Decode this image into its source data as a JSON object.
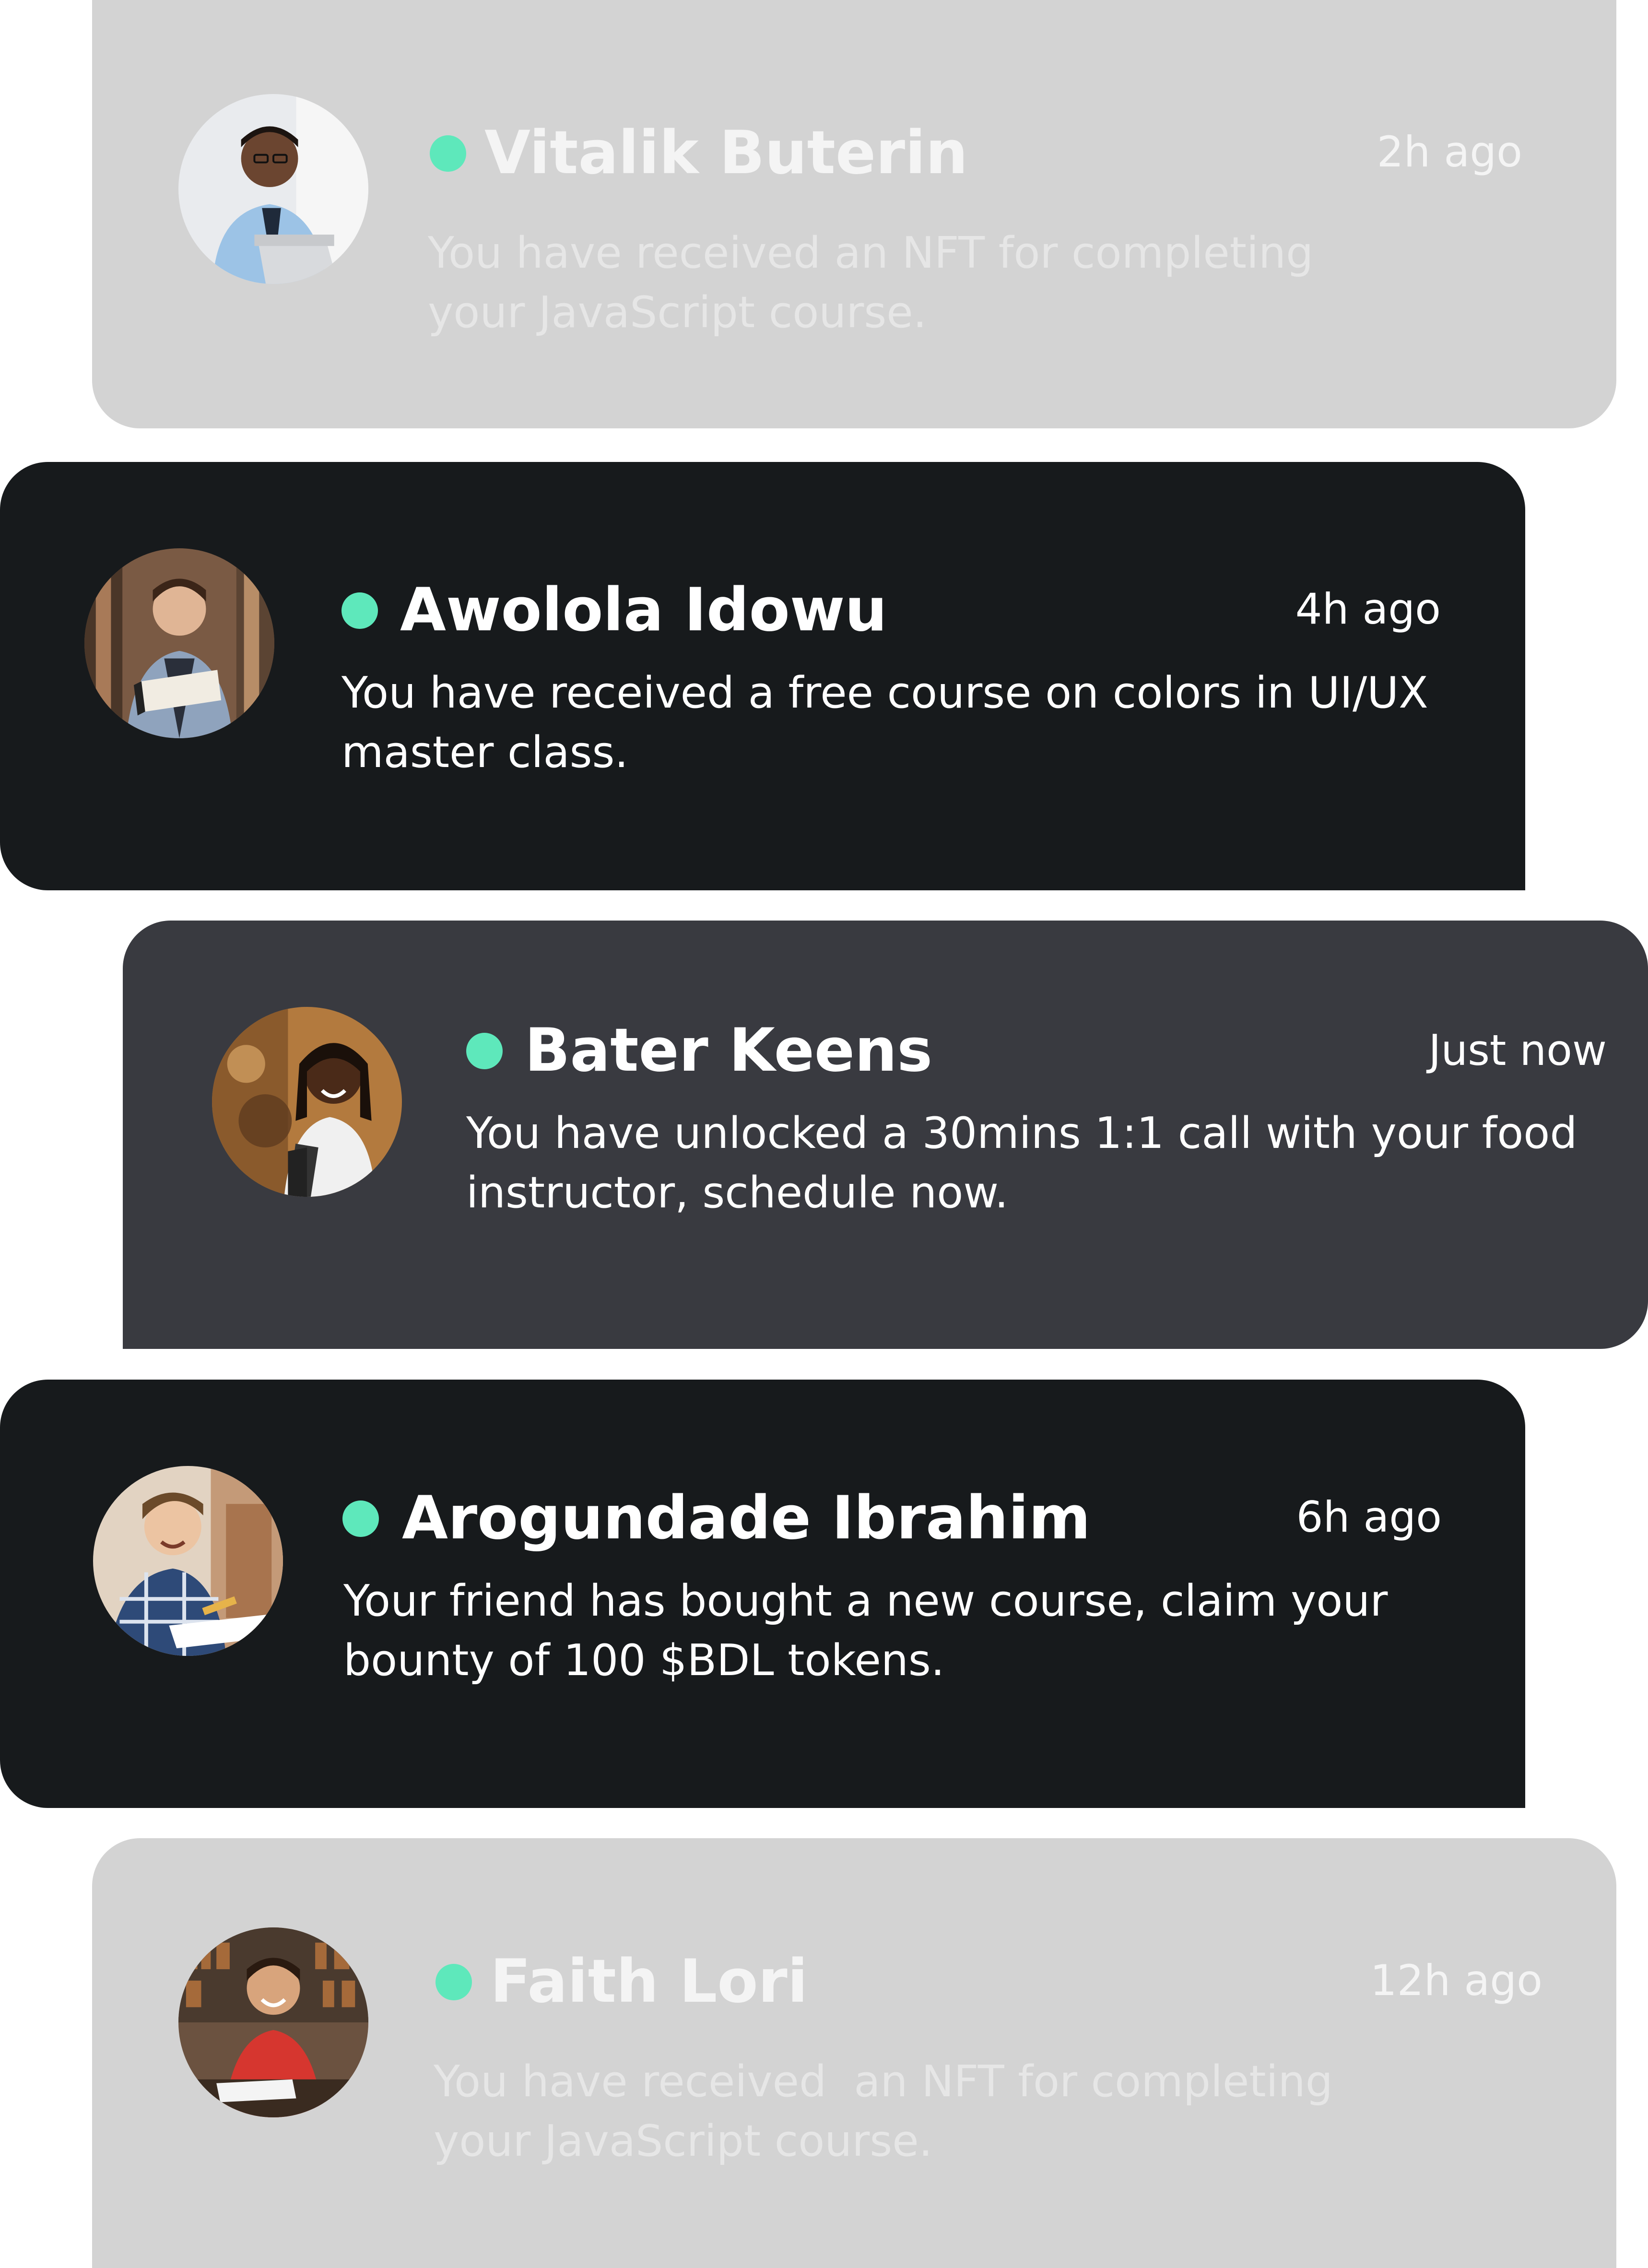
{
  "accent_color": "#5ee8bb",
  "notifications": [
    {
      "name": "Vitalik Buterin",
      "time": "2h ago",
      "message_line1": "You have received an NFT for completing",
      "message_line2": "your JavaScript course.",
      "theme": "light",
      "status": "online",
      "avatar": "man-with-laptop-photo"
    },
    {
      "name": "Awolola Idowu",
      "time": "4h ago",
      "message_line1": "You have received a free course on colors in UI/UX",
      "message_line2": "master class.",
      "theme": "dark",
      "status": "online",
      "avatar": "man-reading-book-photo"
    },
    {
      "name": "Bater Keens",
      "time": "Just now",
      "message_line1": "You have unlocked a 30mins 1:1 call with your food",
      "message_line2": "instructor, schedule now.",
      "theme": "mid",
      "status": "online",
      "avatar": "smiling-woman-backpack-photo"
    },
    {
      "name": "Arogundade Ibrahim",
      "time": "6h ago",
      "message_line1": "Your friend has bought a new course, claim your",
      "message_line2": "bounty of 100 $BDL tokens.",
      "theme": "dark",
      "status": "online",
      "avatar": "boy-writing-photo"
    },
    {
      "name": "Faith Lori",
      "time": "12h ago",
      "message_line1": "You have received  an NFT for completing",
      "message_line2": "your JavaScript course.",
      "theme": "light",
      "status": "online",
      "avatar": "man-red-shirt-library-photo"
    }
  ]
}
